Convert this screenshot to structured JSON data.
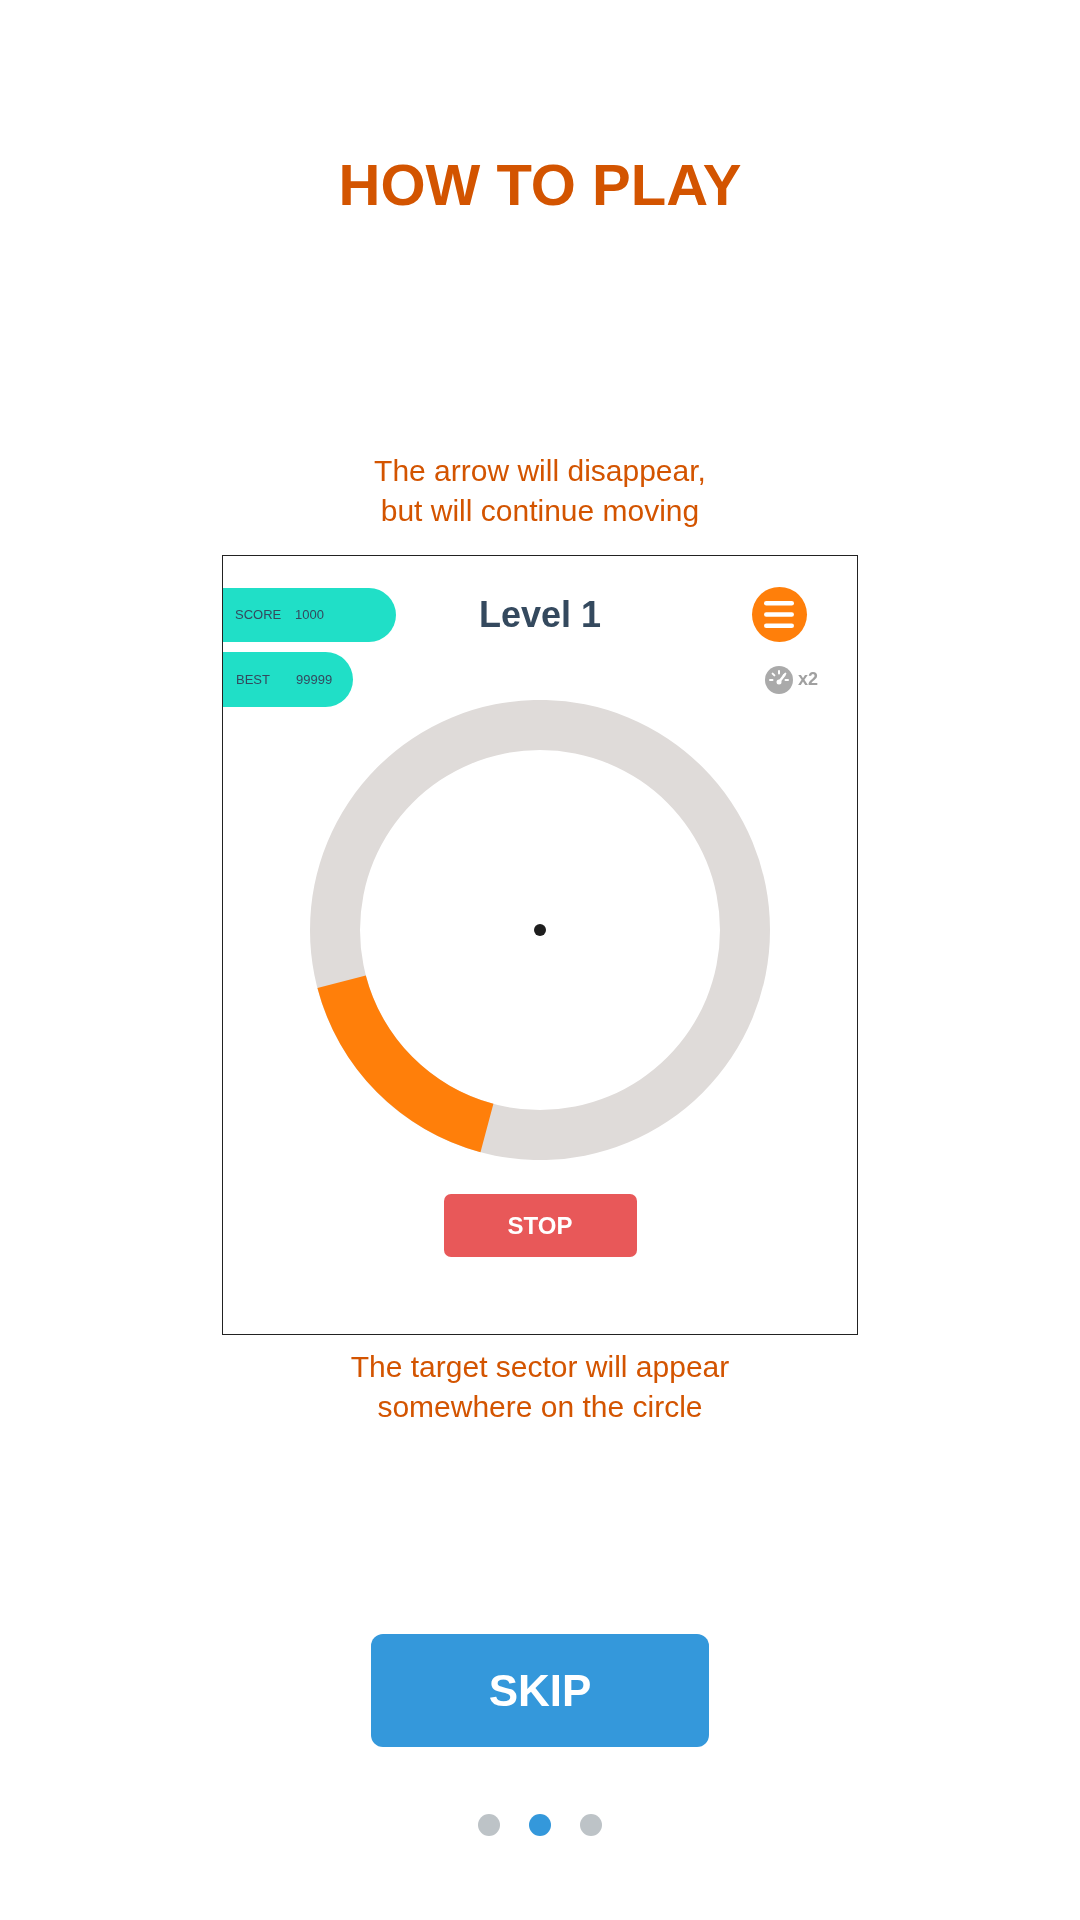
{
  "title": "HOW TO PLAY",
  "top_caption": "The arrow will disappear,\nbut will continue moving",
  "game_preview": {
    "score": {
      "label": "SCORE",
      "value": "1000"
    },
    "best": {
      "label": "BEST",
      "value": "99999"
    },
    "level_title": "Level 1",
    "speed_multiplier": "x2",
    "stop_button": "STOP"
  },
  "bottom_caption": "The target sector will appear\nsomewhere on the circle",
  "skip_button": "SKIP",
  "page_dots": [
    {
      "selected": false
    },
    {
      "selected": true
    },
    {
      "selected": false
    }
  ]
}
